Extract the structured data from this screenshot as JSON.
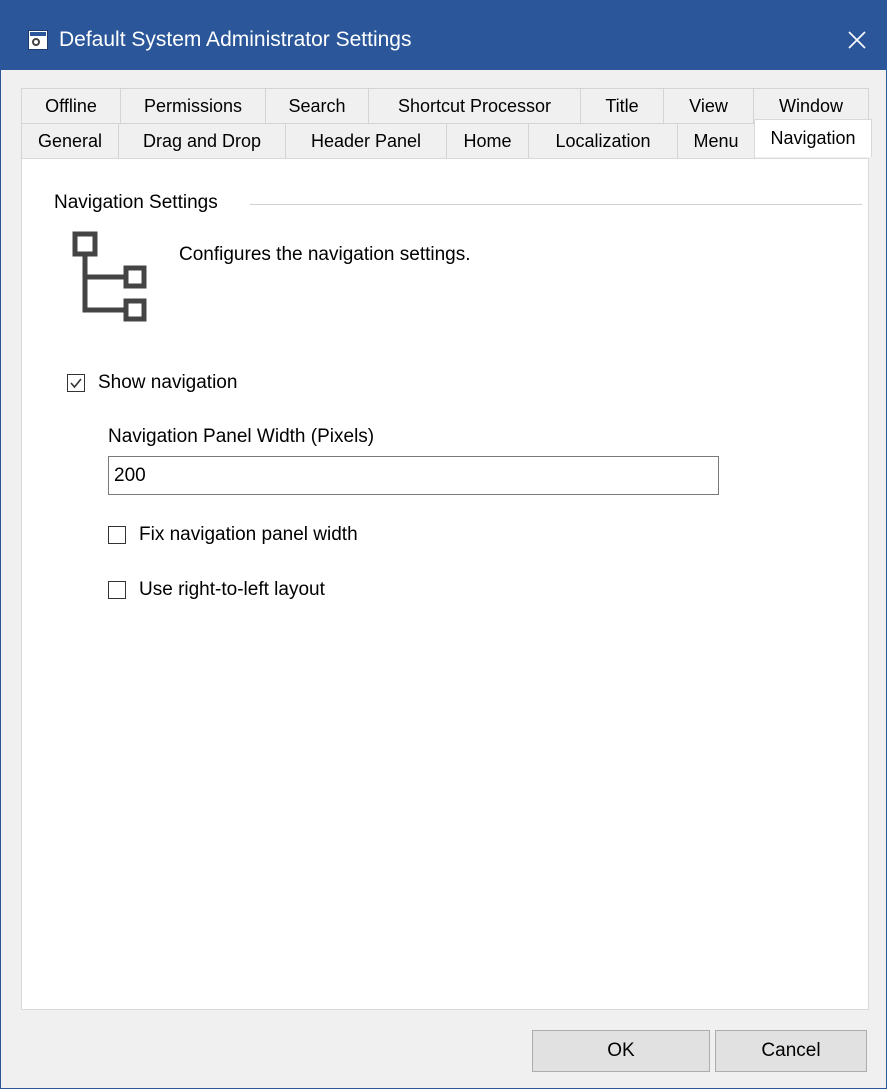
{
  "window": {
    "title": "Default System Administrator Settings"
  },
  "tabs": {
    "row1": [
      "Offline",
      "Permissions",
      "Search",
      "Shortcut Processor",
      "Title",
      "View",
      "Window"
    ],
    "row2": [
      "General",
      "Drag and Drop",
      "Header Panel",
      "Home",
      "Localization",
      "Menu",
      "Navigation"
    ],
    "selected": "Navigation"
  },
  "panel": {
    "group_title": "Navigation Settings",
    "description": "Configures the navigation settings.",
    "icon": "navigation-tree-icon",
    "show_navigation": {
      "label": "Show navigation",
      "checked": true
    },
    "width_label": "Navigation Panel Width (Pixels)",
    "width_value": "200",
    "fix_width": {
      "label": "Fix navigation panel width",
      "checked": false
    },
    "right_to_left": {
      "label": "Use right-to-left layout",
      "checked": false
    }
  },
  "buttons": {
    "ok": "OK",
    "cancel": "Cancel"
  },
  "colors": {
    "titlebar": "#2b579a",
    "background": "#f0f0f0",
    "panel": "#ffffff"
  }
}
